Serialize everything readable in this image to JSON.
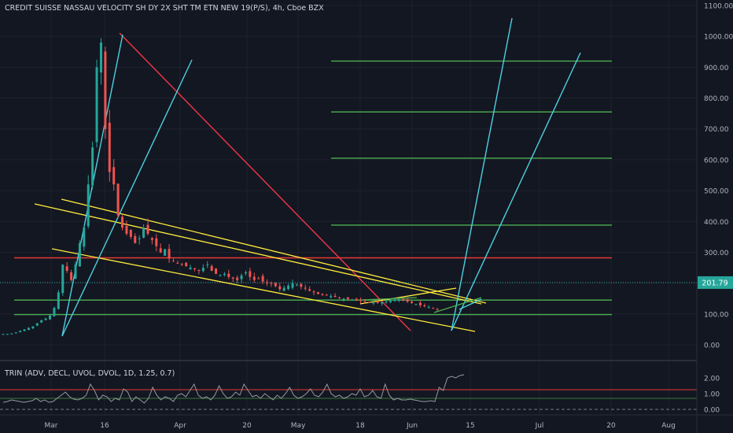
{
  "header": {
    "title": "CREDIT SUISSE NASSAU VELOCITY SH DY 2X SHT TM ETN NEW 19(P/S), 4h, Cboe BZX"
  },
  "indicator": {
    "label": "TRIN (ADV, DECL, UVOL, DVOL, 1D, 1.25, 0.7)",
    "y_ticks": [
      "2.00",
      "1.00",
      "0.00"
    ],
    "levels": [
      {
        "value": 1.25,
        "color": "#e53935"
      },
      {
        "value": 0.7,
        "color": "#3a7a3a"
      }
    ],
    "series": [
      0.45,
      0.5,
      0.6,
      0.55,
      0.5,
      0.45,
      0.5,
      0.55,
      0.7,
      0.5,
      0.6,
      0.45,
      0.5,
      0.7,
      0.9,
      1.1,
      0.8,
      0.65,
      0.6,
      0.7,
      0.9,
      1.6,
      1.2,
      0.6,
      0.9,
      0.8,
      0.5,
      0.7,
      0.6,
      1.3,
      1.1,
      0.5,
      0.8,
      0.6,
      0.4,
      0.7,
      1.4,
      0.9,
      0.6,
      0.8,
      0.7,
      0.5,
      0.9,
      1.0,
      0.8,
      1.2,
      1.6,
      0.9,
      0.7,
      0.8,
      0.6,
      0.9,
      1.5,
      1.0,
      0.7,
      0.8,
      1.1,
      0.9,
      1.6,
      1.2,
      0.8,
      0.9,
      0.7,
      1.0,
      0.8,
      0.6,
      0.9,
      0.7,
      1.0,
      1.4,
      0.9,
      0.7,
      0.8,
      1.0,
      1.3,
      0.9,
      0.8,
      1.1,
      1.6,
      1.0,
      0.8,
      0.9,
      0.7,
      0.8,
      1.0,
      0.9,
      1.3,
      0.8,
      0.9,
      1.2,
      0.8,
      0.7,
      1.6,
      0.9,
      0.6,
      0.7,
      0.6,
      0.6,
      0.65,
      0.6,
      0.55,
      0.5,
      0.5,
      0.55,
      0.5,
      1.4,
      1.2,
      2.0,
      2.1,
      2.0,
      2.15,
      2.2
    ]
  },
  "chart_data": {
    "type": "candlestick",
    "title": "CREDIT SUISSE NASSAU VELOCITY SH DY 2X SHT TM ETN NEW 19(P/S), 4h, Cboe BZX",
    "ylim": [
      0,
      1100
    ],
    "y_ticks": [
      "1100.00",
      "1000.00",
      "900.00",
      "800.00",
      "700.00",
      "600.00",
      "500.00",
      "400.00",
      "300.00",
      "200.00",
      "100.00",
      "0.00"
    ],
    "x_ticks": [
      "Mar",
      "16",
      "Apr",
      "20",
      "May",
      "18",
      "Jun",
      "15",
      "Jul",
      "20",
      "Aug"
    ],
    "last_price": "201.79",
    "grid": true,
    "close_series": [
      35,
      35,
      37,
      40,
      45,
      50,
      55,
      60,
      70,
      80,
      85,
      95,
      120,
      170,
      260,
      240,
      210,
      260,
      330,
      380,
      520,
      640,
      900,
      980,
      700,
      560,
      520,
      420,
      380,
      360,
      350,
      330,
      345,
      380,
      360,
      340,
      320,
      300,
      310,
      280,
      270,
      265,
      260,
      255,
      250,
      245,
      240,
      250,
      260,
      240,
      230,
      225,
      230,
      220,
      215,
      210,
      225,
      235,
      220,
      210,
      215,
      205,
      200,
      198,
      190,
      180,
      185,
      192,
      200,
      195,
      188,
      182,
      175,
      170,
      165,
      162,
      160,
      158,
      155,
      152,
      150,
      148,
      146,
      144,
      142,
      140,
      138,
      137,
      136,
      138,
      140,
      142,
      145,
      148,
      144,
      140,
      136,
      132,
      128,
      125,
      122,
      118,
      116
    ],
    "horizontal_levels": [
      {
        "price": 920,
        "color": "#4caf50"
      },
      {
        "price": 755,
        "color": "#4caf50"
      },
      {
        "price": 605,
        "color": "#4caf50"
      },
      {
        "price": 388,
        "color": "#4caf50"
      },
      {
        "price": 282,
        "color": "#e53935"
      },
      {
        "price": 145,
        "color": "#4caf50"
      },
      {
        "price": 98,
        "color": "#4caf50"
      }
    ],
    "colors": {
      "up": "#26a69a",
      "down": "#ef5350",
      "trendline_red": "#f23645",
      "channel": "#ffeb3b",
      "fan": "#4dd0e1",
      "level_green": "#4caf50",
      "price_line": "#26a69a"
    }
  }
}
